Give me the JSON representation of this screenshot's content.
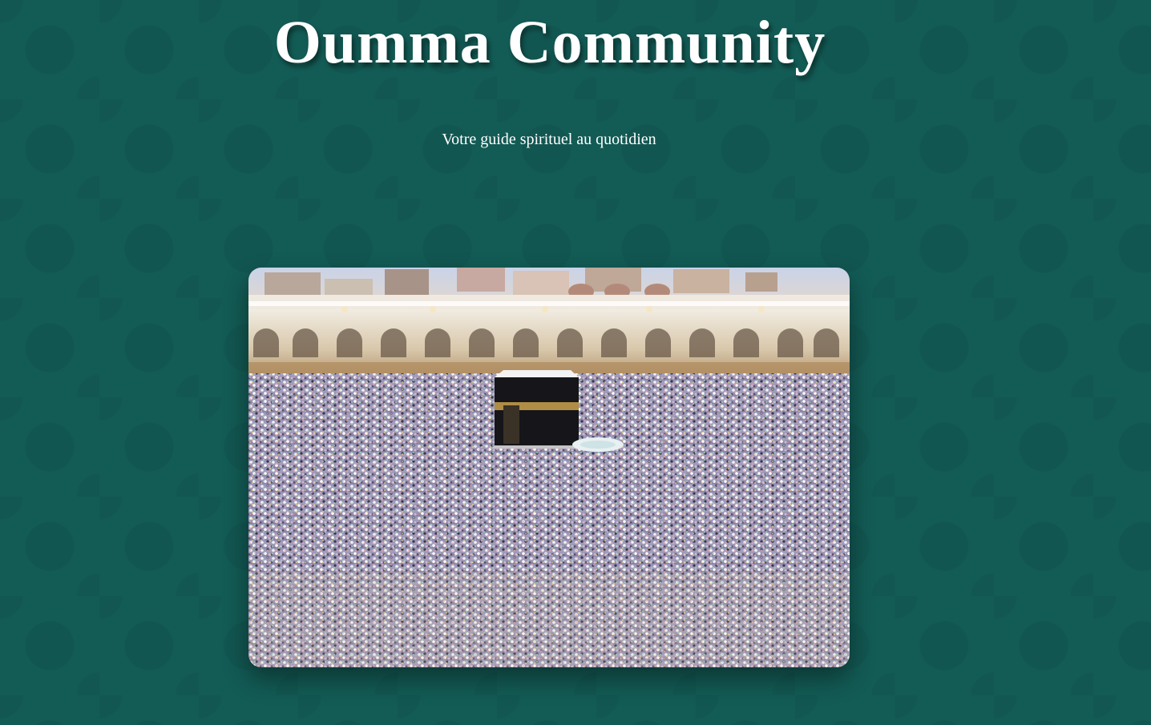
{
  "header": {
    "title": "Oumma Community",
    "tagline": "Votre guide spirituel au quotidien"
  },
  "hero": {
    "image": "kaaba-masjid-al-haram-crowd-photo"
  },
  "colors": {
    "background": "#135b55",
    "text": "#ffffff"
  }
}
